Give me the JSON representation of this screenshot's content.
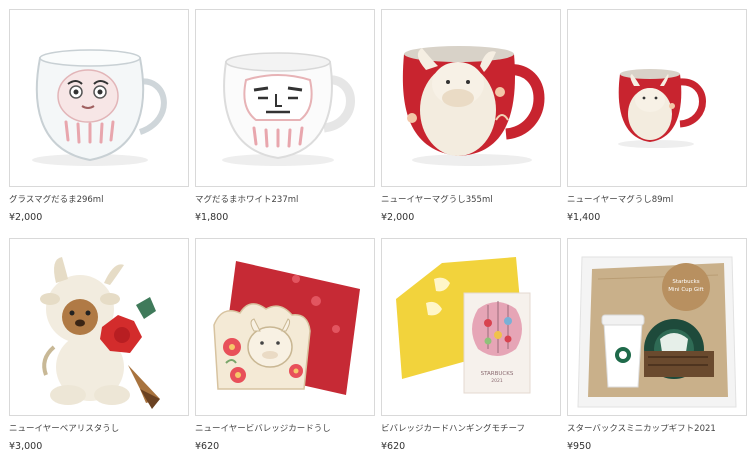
{
  "products": [
    {
      "name": "グラスマグだるま296ml",
      "price": "¥2,000",
      "image": "glass-daruma-mug"
    },
    {
      "name": "マグだるまホワイト237ml",
      "price": "¥1,800",
      "image": "white-daruma-mug"
    },
    {
      "name": "ニューイヤーマグうし355ml",
      "price": "¥2,000",
      "image": "ox-mug-large"
    },
    {
      "name": "ニューイヤーマグうし89ml",
      "price": "¥1,400",
      "image": "ox-mug-small"
    },
    {
      "name": "ニューイヤーベアリスタうし",
      "price": "¥3,000",
      "image": "bearista-ox"
    },
    {
      "name": "ニューイヤービバレッジカードうし",
      "price": "¥620",
      "image": "beverage-card-ox"
    },
    {
      "name": "ビバレッジカードハンギングモチーフ",
      "price": "¥620",
      "image": "beverage-card-hanging"
    },
    {
      "name": "スターバックスミニカップギフト2021",
      "price": "¥950",
      "image": "mini-cup-gift"
    }
  ],
  "gift_label": {
    "line1": "Starbucks",
    "line2": "Mini Cup Gift"
  },
  "card_text": {
    "brand": "STARBUCKS",
    "year": "2021"
  },
  "colors": {
    "ox_red": "#c8242f",
    "daruma_pink": "#e8a6ad",
    "kraft": "#c9b08a"
  }
}
